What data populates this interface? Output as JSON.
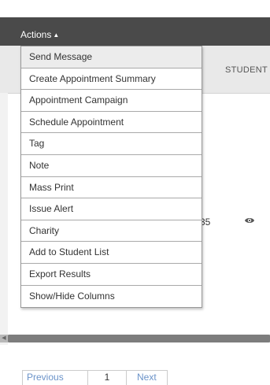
{
  "actions": {
    "label": "Actions",
    "caret": "▲"
  },
  "table": {
    "student_header": "STUDENT",
    "row_value_fragment": "35"
  },
  "menu": {
    "items": [
      "Send Message",
      "Create Appointment Summary",
      "Appointment Campaign",
      "Schedule Appointment",
      "Tag",
      "Note",
      "Mass Print",
      "Issue Alert",
      "Charity",
      "Add to Student List",
      "Export Results",
      "Show/Hide Columns"
    ]
  },
  "pagination": {
    "previous": "Previous",
    "current": "1",
    "next": "Next"
  },
  "icons": {
    "view": "eye-icon",
    "scroll_left": "scroll-left-arrow-icon"
  },
  "colors": {
    "toolbar": "#4a4a4a",
    "link": "#6b93c9",
    "header": "#e9e9e9"
  }
}
